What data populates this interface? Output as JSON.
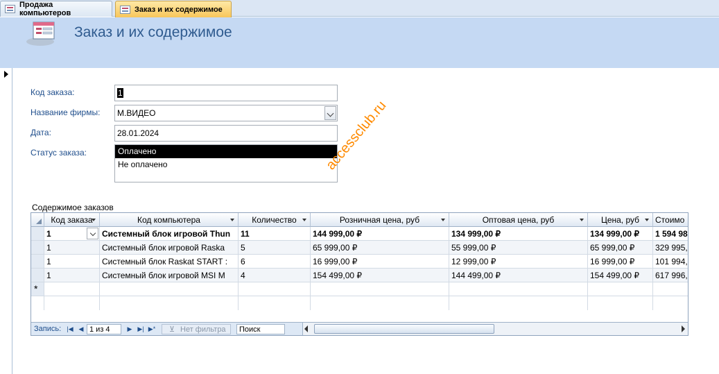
{
  "tabs": [
    {
      "label": "Продажа компьютеров",
      "active": false
    },
    {
      "label": "Заказ и их содержимое",
      "active": true
    }
  ],
  "form": {
    "title": "Заказ и их содержимое",
    "fields": {
      "order_id": {
        "label": "Код заказа:",
        "value": "1"
      },
      "company": {
        "label": "Название фирмы:",
        "value": "М.ВИДЕО"
      },
      "date": {
        "label": "Дата:",
        "value": "28.01.2024"
      },
      "status": {
        "label": "Статус заказа:",
        "options": [
          "Оплачено",
          "Не оплачено"
        ],
        "selected": "Оплачено"
      }
    }
  },
  "watermark": "accessclub.ru",
  "subform": {
    "label": "Содержимое заказов",
    "columns": [
      "Код заказа",
      "Код компьютера",
      "Количество",
      "Розничная цена, руб",
      "Оптовая цена, руб",
      "Цена, руб",
      "Стоимо"
    ],
    "rows": [
      [
        "1",
        "Системный блок игровой Thun",
        "11",
        "144 999,00 ₽",
        "134 999,00 ₽",
        "134 999,00 ₽",
        "1 594 98"
      ],
      [
        "1",
        "Системный блок игровой Raska",
        "5",
        "65 999,00 ₽",
        "55 999,00 ₽",
        "65 999,00 ₽",
        "329 995,"
      ],
      [
        "1",
        "Системный блок Raskat START :",
        "6",
        "16 999,00 ₽",
        "12 999,00 ₽",
        "16 999,00 ₽",
        "101 994,"
      ],
      [
        "1",
        "Системный блок игровой MSI M",
        "4",
        "154 499,00 ₽",
        "144 499,00 ₽",
        "154 499,00 ₽",
        "617 996,"
      ]
    ],
    "new_row_marker": "*",
    "nav": {
      "label": "Запись:",
      "position": "1 из 4",
      "filter": "Нет фильтра",
      "search": "Поиск"
    }
  }
}
